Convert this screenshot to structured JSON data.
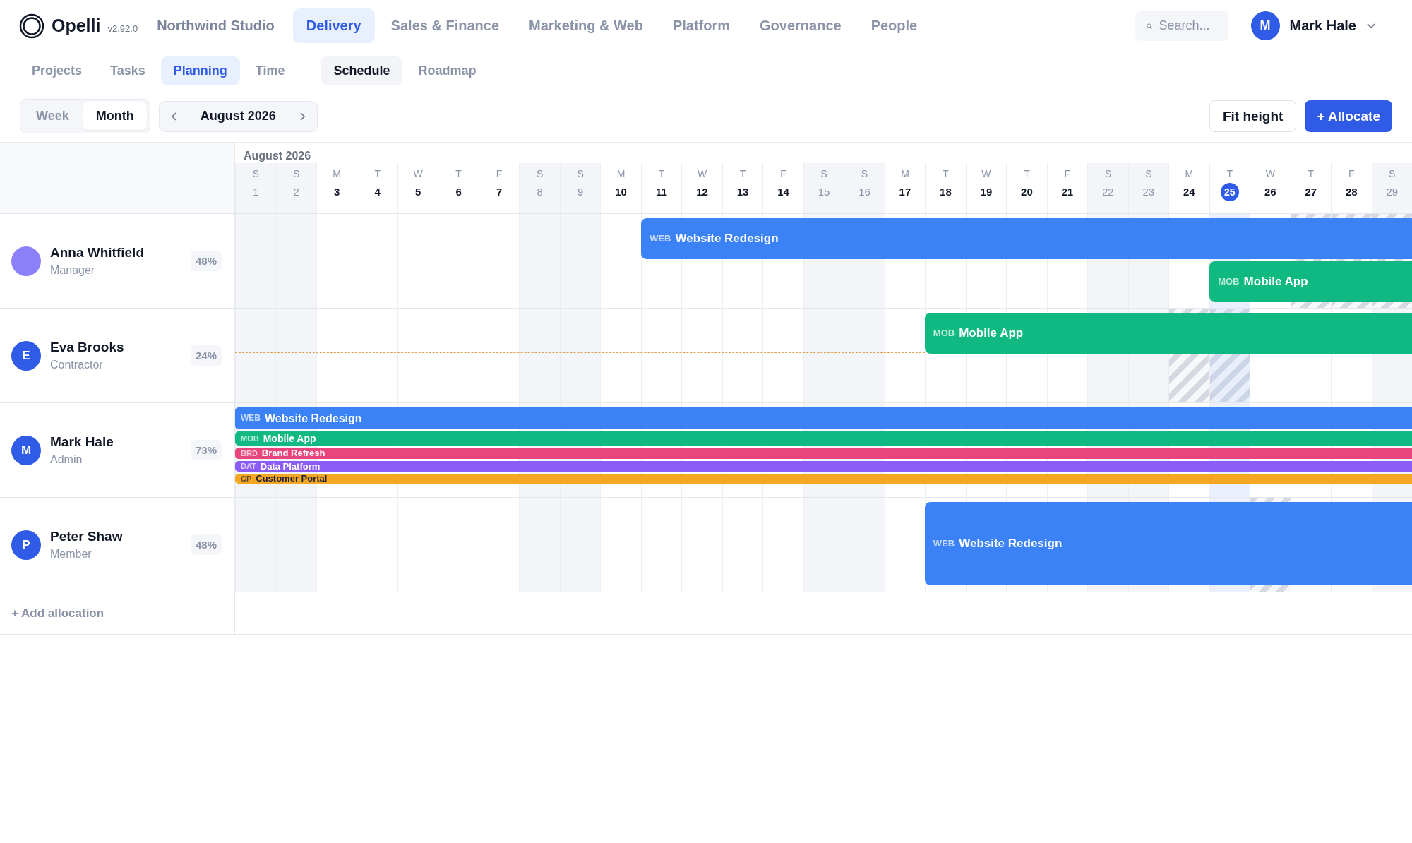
{
  "app": {
    "name": "Opelli",
    "version": "v2.92.0",
    "workspace": "Northwind Studio"
  },
  "nav_tabs": [
    {
      "label": "Delivery",
      "selected": true
    },
    {
      "label": "Sales & Finance",
      "selected": false
    },
    {
      "label": "Marketing & Web",
      "selected": false
    },
    {
      "label": "Platform",
      "selected": false
    },
    {
      "label": "Governance",
      "selected": false
    },
    {
      "label": "People",
      "selected": false
    }
  ],
  "search": {
    "placeholder": "Search..."
  },
  "user": {
    "initial": "M",
    "name": "Mark Hale"
  },
  "sub_tabs": [
    {
      "label": "Projects",
      "selected": false
    },
    {
      "label": "Tasks",
      "selected": false
    },
    {
      "label": "Planning",
      "selected": true
    },
    {
      "label": "Time",
      "selected": false
    }
  ],
  "view_tabs": [
    {
      "label": "Schedule",
      "selected": true
    },
    {
      "label": "Roadmap",
      "selected": false
    }
  ],
  "range_toggle": [
    {
      "label": "Week",
      "selected": false
    },
    {
      "label": "Month",
      "selected": true
    }
  ],
  "period": "August 2026",
  "actions": {
    "fit": "Fit height",
    "allocate": "+ Allocate"
  },
  "calendar": {
    "month": "August 2026",
    "days": [
      {
        "weekday": "S",
        "date": "1",
        "weekend": true,
        "today": false
      },
      {
        "weekday": "S",
        "date": "2",
        "weekend": true,
        "today": false
      },
      {
        "weekday": "M",
        "date": "3",
        "weekend": false,
        "today": false
      },
      {
        "weekday": "T",
        "date": "4",
        "weekend": false,
        "today": false
      },
      {
        "weekday": "W",
        "date": "5",
        "weekend": false,
        "today": false
      },
      {
        "weekday": "T",
        "date": "6",
        "weekend": false,
        "today": false
      },
      {
        "weekday": "F",
        "date": "7",
        "weekend": false,
        "today": false
      },
      {
        "weekday": "S",
        "date": "8",
        "weekend": true,
        "today": false
      },
      {
        "weekday": "S",
        "date": "9",
        "weekend": true,
        "today": false
      },
      {
        "weekday": "M",
        "date": "10",
        "weekend": false,
        "today": false
      },
      {
        "weekday": "T",
        "date": "11",
        "weekend": false,
        "today": false
      },
      {
        "weekday": "W",
        "date": "12",
        "weekend": false,
        "today": false
      },
      {
        "weekday": "T",
        "date": "13",
        "weekend": false,
        "today": false
      },
      {
        "weekday": "F",
        "date": "14",
        "weekend": false,
        "today": false
      },
      {
        "weekday": "S",
        "date": "15",
        "weekend": true,
        "today": false
      },
      {
        "weekday": "S",
        "date": "16",
        "weekend": true,
        "today": false
      },
      {
        "weekday": "M",
        "date": "17",
        "weekend": false,
        "today": false
      },
      {
        "weekday": "T",
        "date": "18",
        "weekend": false,
        "today": false
      },
      {
        "weekday": "W",
        "date": "19",
        "weekend": false,
        "today": false
      },
      {
        "weekday": "T",
        "date": "20",
        "weekend": false,
        "today": false
      },
      {
        "weekday": "F",
        "date": "21",
        "weekend": false,
        "today": false
      },
      {
        "weekday": "S",
        "date": "22",
        "weekend": true,
        "today": false
      },
      {
        "weekday": "S",
        "date": "23",
        "weekend": true,
        "today": false
      },
      {
        "weekday": "M",
        "date": "24",
        "weekend": false,
        "today": false
      },
      {
        "weekday": "T",
        "date": "25",
        "weekend": false,
        "today": true
      },
      {
        "weekday": "W",
        "date": "26",
        "weekend": false,
        "today": false
      },
      {
        "weekday": "T",
        "date": "27",
        "weekend": false,
        "today": false
      },
      {
        "weekday": "F",
        "date": "28",
        "weekend": false,
        "today": false
      },
      {
        "weekday": "S",
        "date": "29",
        "weekend": true,
        "today": false
      }
    ]
  },
  "people": [
    {
      "name": "Anna Whitfield",
      "role": "Manager",
      "utilization": "48%",
      "avatar": {
        "kind": "plain",
        "color": "#8b80f9"
      },
      "kind": "lanes",
      "lead_line": false,
      "off_days": [
        false,
        false,
        false,
        false,
        false,
        false,
        false,
        false,
        false,
        false,
        false,
        false,
        false,
        false,
        false,
        false,
        false,
        false,
        false,
        false,
        false,
        false,
        false,
        false,
        false,
        false,
        true,
        true,
        true
      ],
      "allocations": [
        {
          "code": "WEB",
          "project": "Website Redesign",
          "color": "#3b82f6",
          "level": 0.655,
          "dark_label": false
        },
        {
          "code": "MOB",
          "project": "Mobile App",
          "color": "#10b981",
          "level": 0.172,
          "dark_label": false
        }
      ]
    },
    {
      "name": "Eva Brooks",
      "role": "Contractor",
      "utilization": "24%",
      "avatar": {
        "kind": "initial",
        "initial": "E",
        "color": "#2f5be6"
      },
      "kind": "lanes",
      "lead_line": true,
      "off_days": [
        false,
        false,
        false,
        false,
        false,
        false,
        false,
        false,
        false,
        false,
        false,
        false,
        false,
        false,
        false,
        false,
        false,
        false,
        false,
        false,
        false,
        false,
        false,
        true,
        true,
        false,
        false,
        false,
        false
      ],
      "allocations": [
        {
          "code": "MOB",
          "project": "Mobile App",
          "color": "#10b981",
          "level": 0.414,
          "dark_label": false
        }
      ]
    },
    {
      "name": "Mark Hale",
      "role": "Admin",
      "utilization": "73%",
      "avatar": {
        "kind": "initial",
        "initial": "M",
        "color": "#2f5be6"
      },
      "kind": "compact",
      "lead_line": false,
      "off_days": [
        false,
        false,
        false,
        false,
        false,
        false,
        false,
        false,
        false,
        false,
        false,
        false,
        false,
        false,
        false,
        false,
        false,
        false,
        false,
        false,
        false,
        false,
        false,
        false,
        false,
        false,
        false,
        false,
        false
      ],
      "allocations": [
        {
          "code": "WEB",
          "project": "Website Redesign",
          "color": "#3b82f6",
          "level": 1,
          "dark_label": false
        },
        {
          "code": "MOB",
          "project": "Mobile App",
          "color": "#10b981",
          "level": 1,
          "dark_label": false
        },
        {
          "code": "BRD",
          "project": "Brand Refresh",
          "color": "#e8457c",
          "level": 1,
          "dark_label": false
        },
        {
          "code": "DAT",
          "project": "Data Platform",
          "color": "#8b5cf6",
          "level": 1,
          "dark_label": false
        },
        {
          "code": "CP",
          "project": "Customer Portal",
          "color": "#f5a623",
          "level": 1,
          "dark_label": true
        }
      ]
    },
    {
      "name": "Peter Shaw",
      "role": "Member",
      "utilization": "48%",
      "avatar": {
        "kind": "initial",
        "initial": "P",
        "color": "#2f5be6"
      },
      "kind": "full",
      "lead_line": false,
      "off_days": [
        false,
        false,
        false,
        false,
        false,
        false,
        false,
        false,
        false,
        false,
        false,
        false,
        false,
        false,
        false,
        false,
        false,
        false,
        false,
        false,
        false,
        false,
        false,
        false,
        false,
        true,
        false,
        false,
        false
      ],
      "allocations": [
        {
          "code": "WEB",
          "project": "Website Redesign",
          "color": "#3b82f6",
          "level": 0.414,
          "dark_label": false
        }
      ]
    }
  ],
  "add_label": "+ Add allocation"
}
